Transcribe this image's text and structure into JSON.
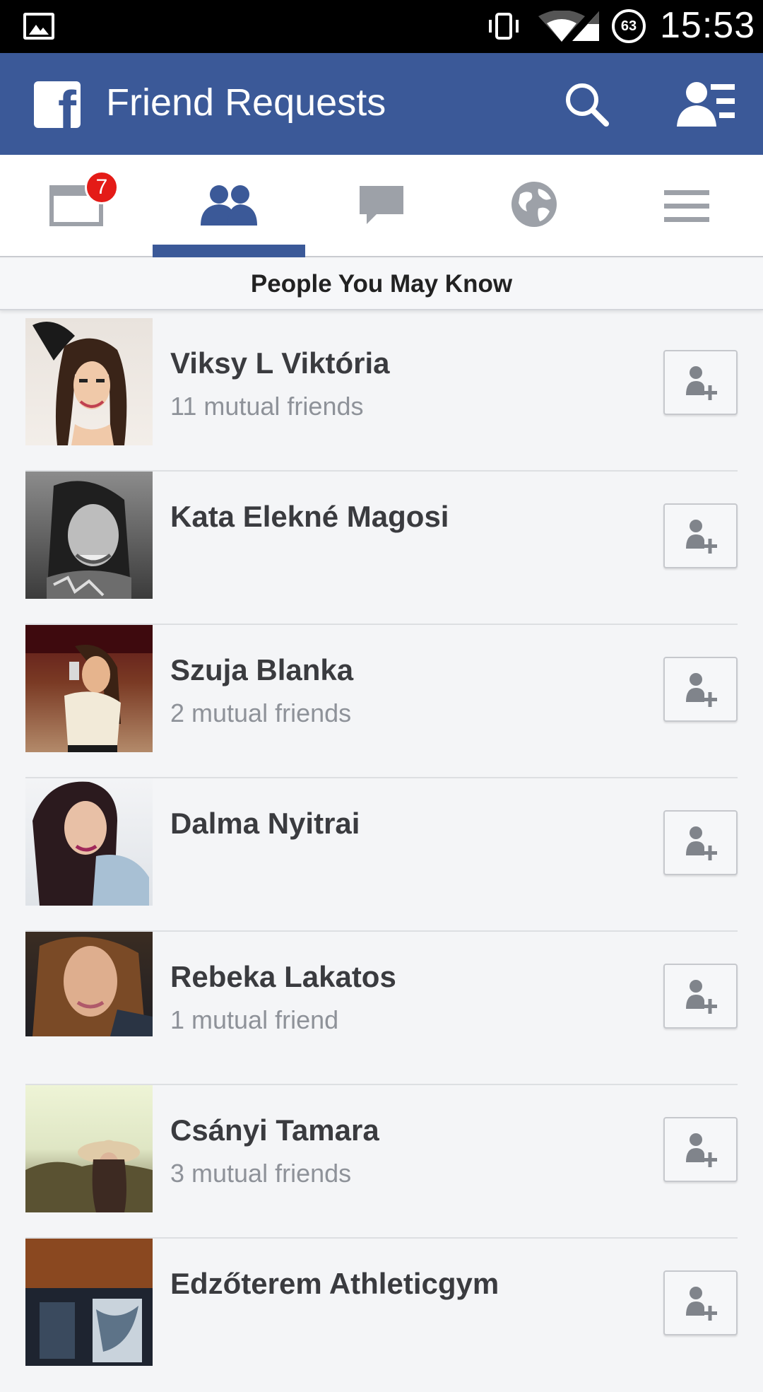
{
  "status_bar": {
    "time": "15:53",
    "battery": "63",
    "icons": [
      "gallery-icon",
      "vibrate-icon",
      "wifi-icon",
      "signal-icon",
      "battery-icon"
    ]
  },
  "header": {
    "logo": "f",
    "title": "Friend Requests",
    "icons": [
      "search-icon",
      "friend-requests-icon"
    ],
    "background_color": "#3b5998"
  },
  "tabs": [
    {
      "icon": "news-feed-icon",
      "badge": "7",
      "active": false
    },
    {
      "icon": "friends-icon",
      "active": true
    },
    {
      "icon": "messages-icon",
      "active": false
    },
    {
      "icon": "notifications-globe-icon",
      "active": false
    },
    {
      "icon": "menu-icon",
      "active": false
    }
  ],
  "section": {
    "title": "People You May Know"
  },
  "people": [
    {
      "name": "Viksy L Viktória",
      "mutual": "11 mutual friends"
    },
    {
      "name": "Kata Elekné Magosi",
      "mutual": ""
    },
    {
      "name": "Szuja Blanka",
      "mutual": "2 mutual friends"
    },
    {
      "name": "Dalma Nyitrai",
      "mutual": ""
    },
    {
      "name": "Rebeka Lakatos",
      "mutual": "1 mutual friend"
    },
    {
      "name": "Csányi Tamara",
      "mutual": "3 mutual friends"
    },
    {
      "name": "Edzőterem Athleticgym",
      "mutual": ""
    }
  ],
  "colors": {
    "brand": "#3b5998",
    "badge": "#e41b17",
    "inactive_icon": "#9da1a8"
  }
}
